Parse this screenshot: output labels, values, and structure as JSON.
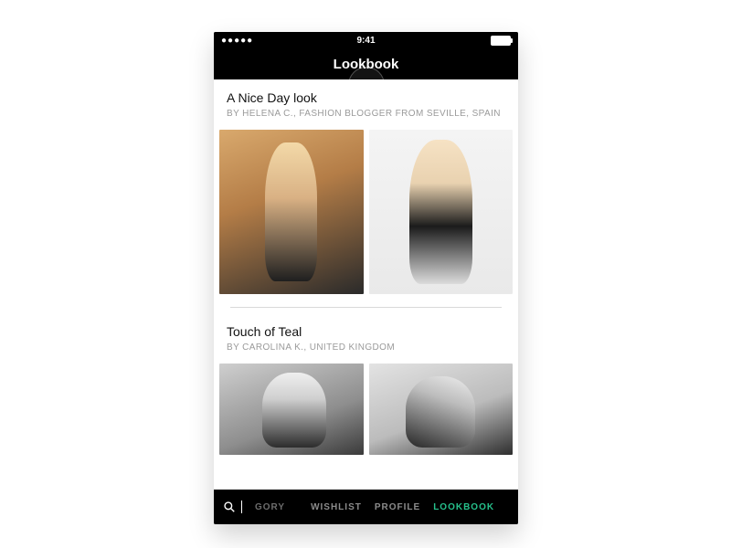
{
  "colors": {
    "accent": "#26c08b",
    "bg": "#000000",
    "text_muted": "#9a9a9a"
  },
  "statusbar": {
    "signal": "●●●●●",
    "time": "9:41"
  },
  "navbar": {
    "title": "Lookbook"
  },
  "feed": [
    {
      "title": "A Nice Day look",
      "byline": "BY HELENA C., FASHION BLOGGER FROM SEVILLE, SPAIN",
      "image_alts": [
        "look photo 1",
        "look photo 2"
      ]
    },
    {
      "title": "Touch of Teal",
      "byline": "BY CAROLINA K., UNITED KINGDOM",
      "image_alts": [
        "look photo 1",
        "look photo 2"
      ]
    }
  ],
  "tabbar": {
    "search_icon": "search",
    "partial_tab_text": "GORY",
    "tabs": [
      {
        "label": "WISHLIST",
        "active": false
      },
      {
        "label": "PROFILE",
        "active": false
      },
      {
        "label": "LOOKBOOK",
        "active": true
      }
    ]
  }
}
